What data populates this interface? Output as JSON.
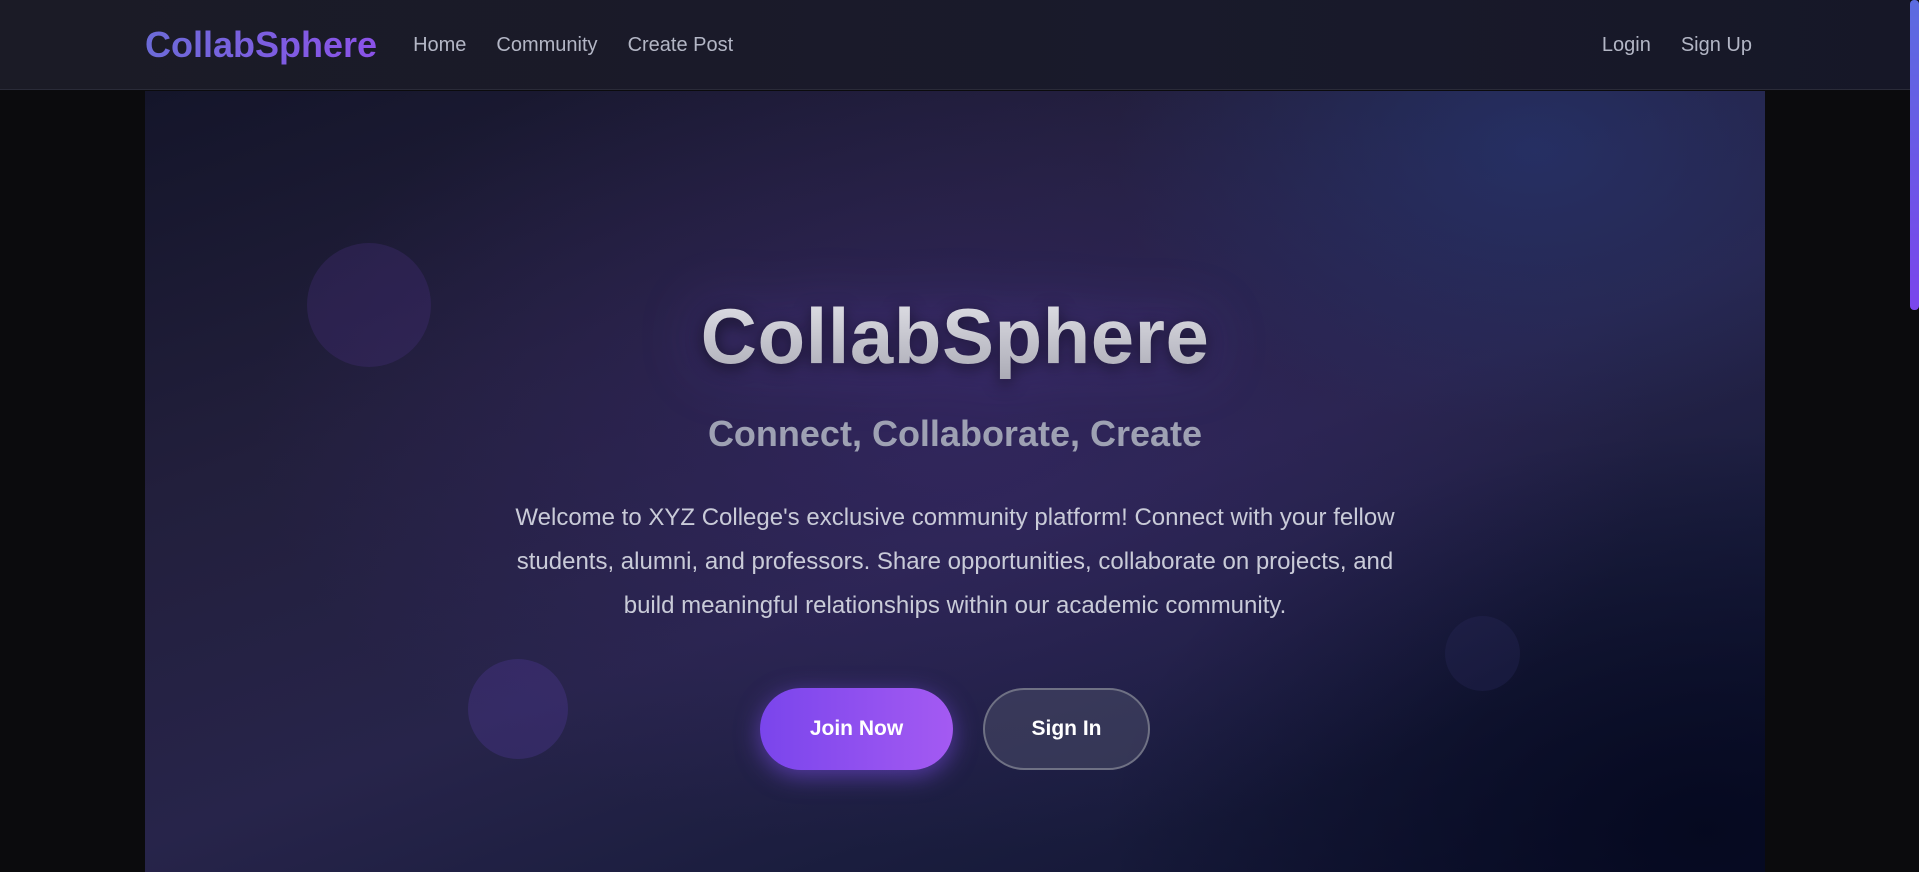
{
  "navbar": {
    "brand": "CollabSphere",
    "links": [
      {
        "label": "Home"
      },
      {
        "label": "Community"
      },
      {
        "label": "Create Post"
      }
    ],
    "auth": {
      "login": "Login",
      "signup": "Sign Up"
    }
  },
  "hero": {
    "title": "CollabSphere",
    "subtitle": "Connect, Collaborate, Create",
    "description": "Welcome to XYZ College's exclusive community platform! Connect with your fellow students, alumni, and professors. Share opportunities, collaborate on projects, and build meaningful relationships within our academic community.",
    "join_button": "Join Now",
    "signin_button": "Sign In"
  },
  "colors": {
    "accent": "#7a45ec",
    "brand_gradient_start": "#6c6bd8",
    "brand_gradient_end": "#8b52e8",
    "background": "#0b0b0d"
  }
}
